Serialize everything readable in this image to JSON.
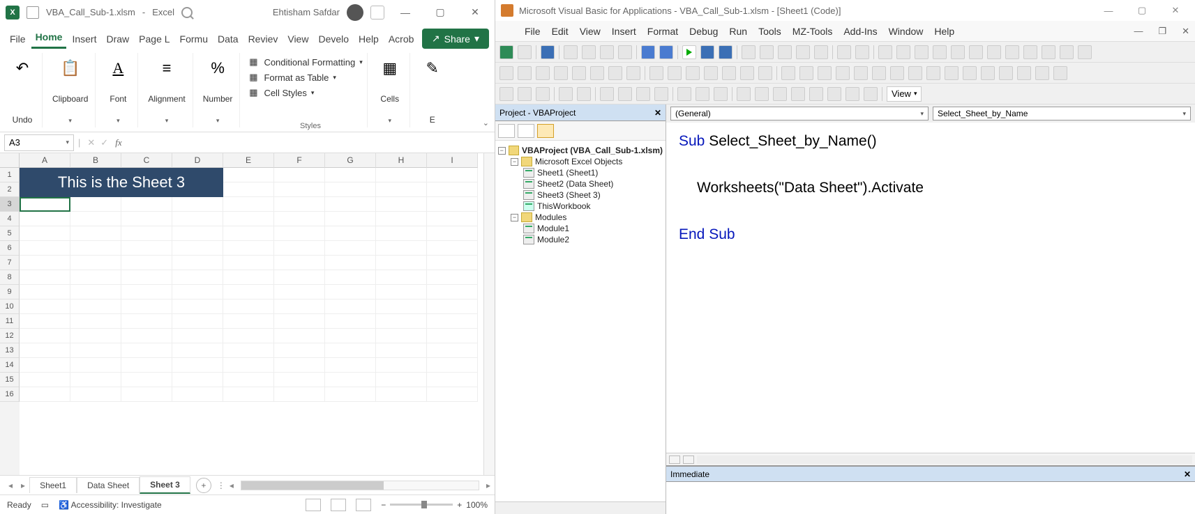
{
  "excel": {
    "title_file": "VBA_Call_Sub-1.xlsm",
    "title_app": "Excel",
    "user": "Ehtisham Safdar",
    "ribbon_tabs": [
      "File",
      "Home",
      "Insert",
      "Draw",
      "Page L",
      "Formu",
      "Data",
      "Reviev",
      "View",
      "Develo",
      "Help",
      "Acrob"
    ],
    "active_tab": "Home",
    "share": "Share",
    "groups": {
      "undo": "Undo",
      "clipboard": "Clipboard",
      "font": "Font",
      "alignment": "Alignment",
      "number": "Number",
      "cells": "Cells",
      "editing": "E"
    },
    "style_rows": {
      "cf": "Conditional Formatting",
      "ft": "Format as Table",
      "cs": "Cell Styles"
    },
    "styles_label": "Styles",
    "namebox": "A3",
    "cols": [
      "A",
      "B",
      "C",
      "D",
      "E",
      "F",
      "G",
      "H",
      "I"
    ],
    "rows": 16,
    "merged_text": "This is the Sheet 3",
    "sheet_tabs": [
      "Sheet1",
      "Data Sheet",
      "Sheet 3"
    ],
    "active_sheet": "Sheet 3",
    "status_ready": "Ready",
    "status_acc": "Accessibility: Investigate",
    "zoom": "100%"
  },
  "vbe": {
    "title": "Microsoft Visual Basic for Applications - VBA_Call_Sub-1.xlsm - [Sheet1 (Code)]",
    "menus": [
      "File",
      "Edit",
      "View",
      "Insert",
      "Format",
      "Debug",
      "Run",
      "Tools",
      "MZ-Tools",
      "Add-Ins",
      "Window",
      "Help"
    ],
    "view_label": "View",
    "project_title": "Project - VBAProject",
    "tree": {
      "root": "VBAProject (VBA_Call_Sub-1.xlsm)",
      "excel_objects": "Microsoft Excel Objects",
      "sheets": [
        "Sheet1 (Sheet1)",
        "Sheet2 (Data Sheet)",
        "Sheet3 (Sheet 3)",
        "ThisWorkbook"
      ],
      "modules_label": "Modules",
      "modules": [
        "Module1",
        "Module2"
      ]
    },
    "dd_left": "(General)",
    "dd_right": "Select_Sheet_by_Name",
    "code": {
      "l1a": "Sub",
      "l1b": " Select_Sheet_by_Name()",
      "l2": "Worksheets(\"Data Sheet\").Activate",
      "l3": "End Sub"
    },
    "immediate": "Immediate"
  }
}
